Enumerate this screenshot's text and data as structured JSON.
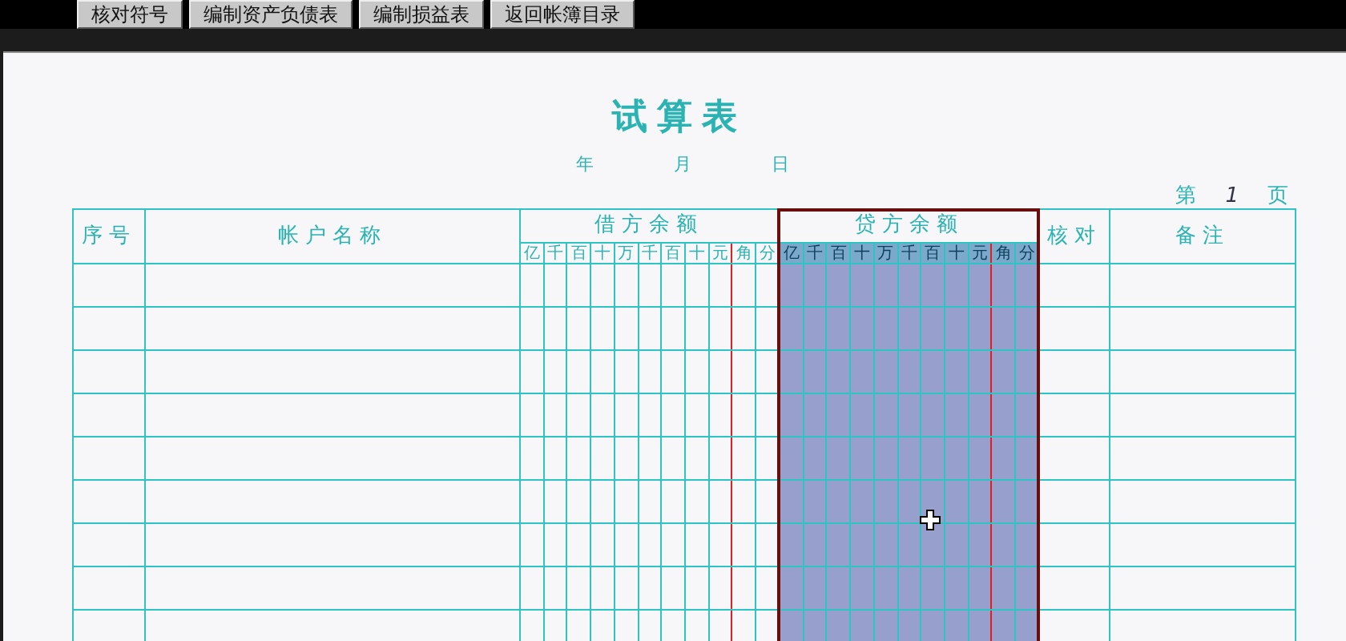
{
  "toolbar": {
    "buttons": [
      {
        "label": "核对符号"
      },
      {
        "label": "编制资产负债表"
      },
      {
        "label": "编制损益表"
      },
      {
        "label": "返回帐簿目录"
      }
    ]
  },
  "title": "试算表",
  "date_line": {
    "year": "年",
    "month": "月",
    "day": "日"
  },
  "page_number": {
    "prefix": "第",
    "value": "1",
    "suffix": "页"
  },
  "table": {
    "columns": [
      {
        "kind": "text",
        "label": "序号",
        "selected": false
      },
      {
        "kind": "text",
        "label": "帐户名称",
        "selected": false
      },
      {
        "kind": "amount",
        "label": "借方余额",
        "selected": false,
        "digits": [
          "亿",
          "千",
          "百",
          "十",
          "万",
          "千",
          "百",
          "十",
          "元",
          "角",
          "分"
        ]
      },
      {
        "kind": "amount",
        "label": "贷方余额",
        "selected": true,
        "digits": [
          "亿",
          "千",
          "百",
          "十",
          "万",
          "千",
          "百",
          "十",
          "元",
          "角",
          "分"
        ]
      },
      {
        "kind": "text",
        "label": "核对",
        "selected": false
      },
      {
        "kind": "text",
        "label": "备注",
        "selected": false
      }
    ]
  }
}
